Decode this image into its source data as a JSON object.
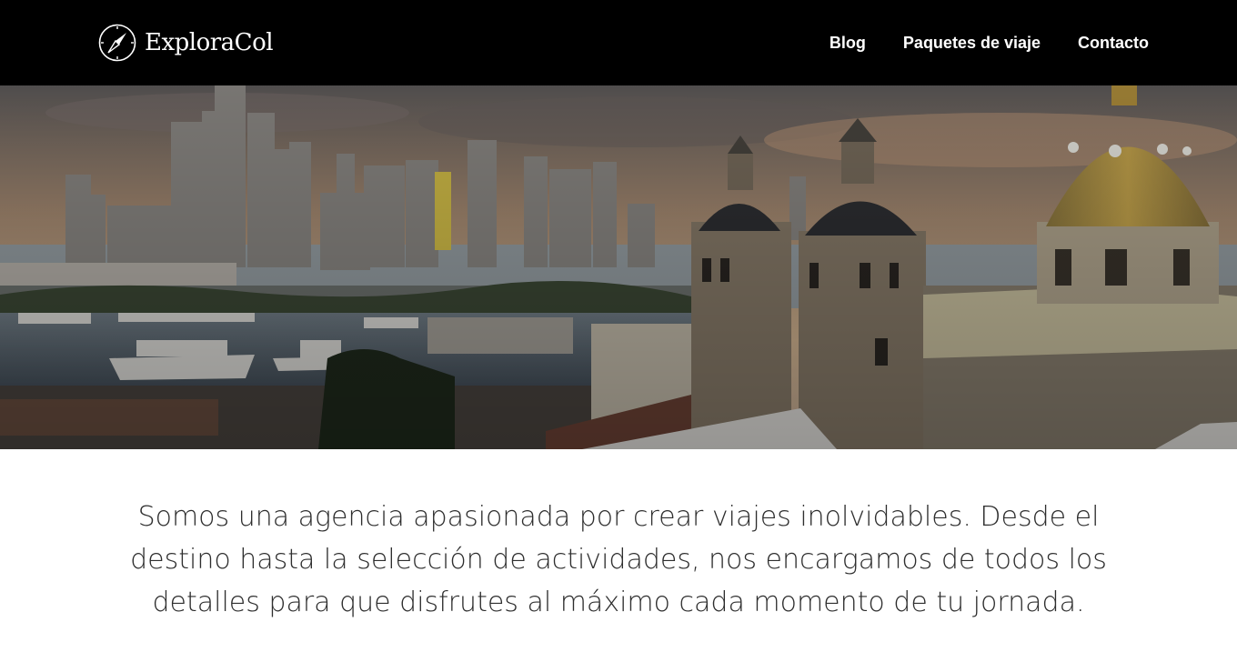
{
  "brand": {
    "name": "ExploraCol",
    "icon": "compass-icon"
  },
  "nav": {
    "items": [
      {
        "label": "Blog"
      },
      {
        "label": "Paquetes de viaje"
      },
      {
        "label": "Contacto"
      }
    ]
  },
  "hero": {
    "image": "cartagena-skyline-cathedral-photo"
  },
  "intro": {
    "lines": [
      "Somos una agencia apasionada por crear viajes inolvidables. Desde el",
      "destino hasta la selección de actividades, nos encargamos de todos los",
      "detalles para que disfrutes al máximo cada momento de tu jornada."
    ]
  },
  "colors": {
    "navbar_bg": "#000000",
    "nav_text": "#ffffff",
    "body_text": "#2e2e2e"
  }
}
